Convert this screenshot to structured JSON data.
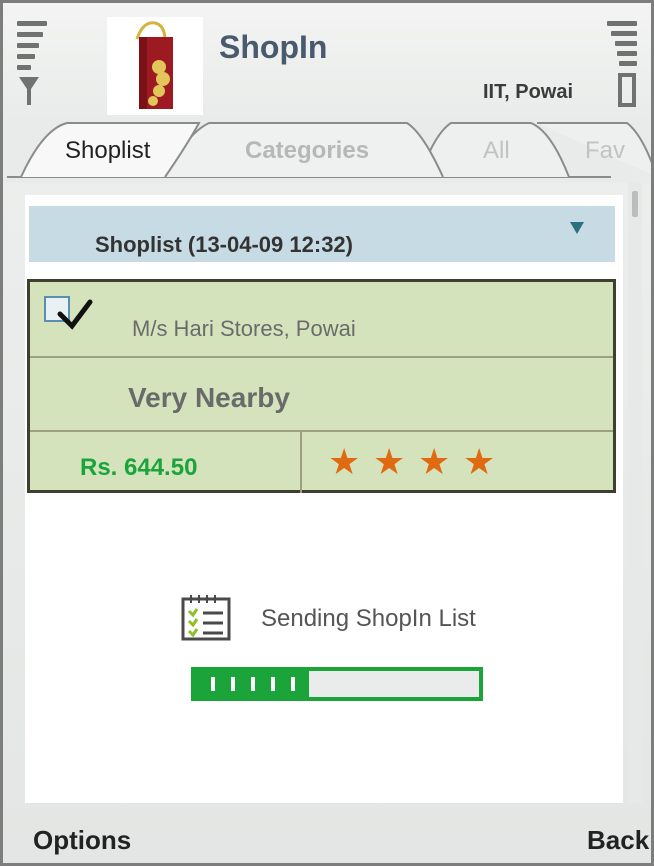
{
  "header": {
    "app_title": "ShopIn",
    "location": "IIT, Powai",
    "logo_icon": "shopping-bag-icon",
    "signal_icon": "signal-strength-icon",
    "battery_icon": "battery-level-icon"
  },
  "tabs": [
    {
      "label": "Shoplist",
      "active": true
    },
    {
      "label": "Categories",
      "active": false
    },
    {
      "label": "All",
      "active": false
    },
    {
      "label": "Fav",
      "active": false
    }
  ],
  "dropdown": {
    "label": "Shoplist (13-04-09 12:32)",
    "icon": "dropdown-triangle-icon"
  },
  "shop_card": {
    "checked": true,
    "name": "M/s Hari Stores, Powai",
    "distance": "Very Nearby",
    "price": "Rs. 644.50",
    "rating_stars": 4,
    "star_glyph": "★"
  },
  "status": {
    "icon": "checklist-icon",
    "text": "Sending ShopIn List",
    "progress_fraction": 0.4,
    "progress_segments": 5
  },
  "softkeys": {
    "left": "Options",
    "right": "Back"
  },
  "colors": {
    "accent_green": "#1aa43a",
    "star_orange": "#e06a12",
    "card_bg": "#d5e3bd",
    "dropdown_bg": "#c7dbe5"
  }
}
